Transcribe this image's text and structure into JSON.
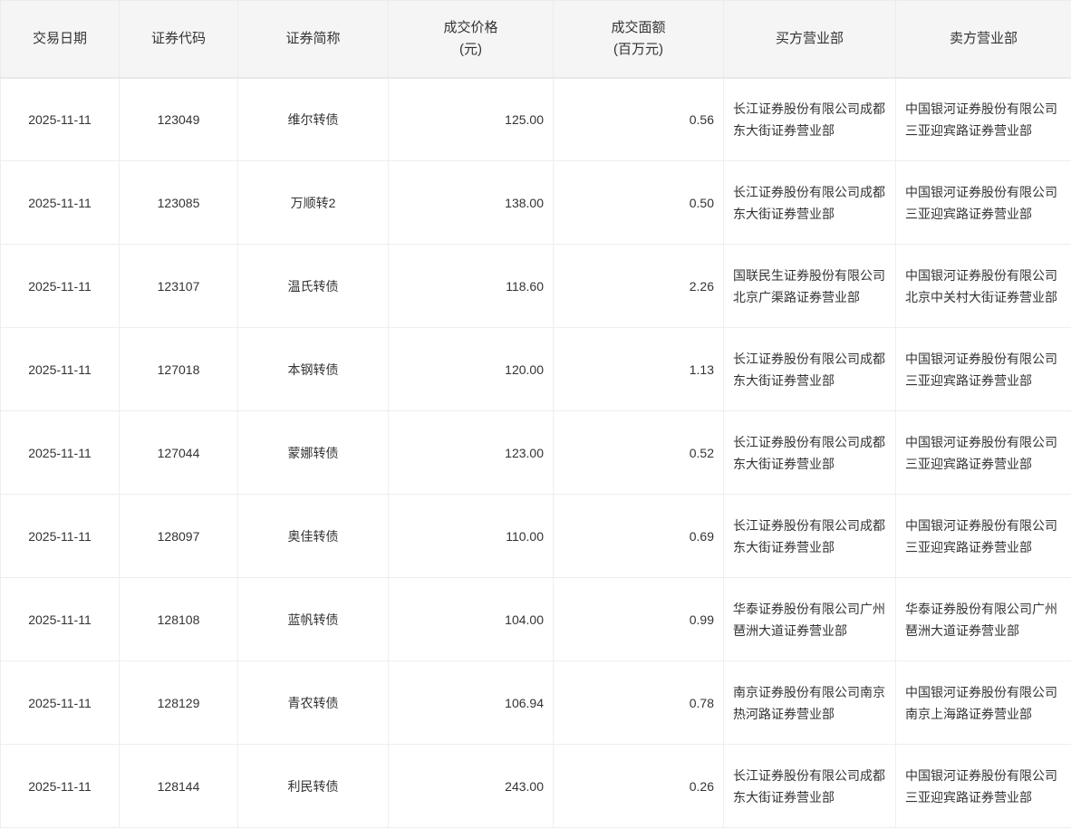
{
  "table": {
    "columns": [
      {
        "key": "date",
        "label": "交易日期",
        "align": "center"
      },
      {
        "key": "code",
        "label": "证券代码",
        "align": "center"
      },
      {
        "key": "name",
        "label": "证券简称",
        "align": "center"
      },
      {
        "key": "price",
        "label": "成交价格\n(元)",
        "align": "right"
      },
      {
        "key": "amount",
        "label": "成交面额\n(百万元)",
        "align": "right"
      },
      {
        "key": "buyer",
        "label": "买方营业部",
        "align": "left"
      },
      {
        "key": "seller",
        "label": "卖方营业部",
        "align": "left"
      }
    ],
    "rows": [
      {
        "date": "2025-11-11",
        "code": "123049",
        "name": "维尔转债",
        "price": "125.00",
        "amount": "0.56",
        "buyer": "长江证券股份有限公司成都东大街证券营业部",
        "seller": "中国银河证券股份有限公司三亚迎宾路证券营业部"
      },
      {
        "date": "2025-11-11",
        "code": "123085",
        "name": "万顺转2",
        "price": "138.00",
        "amount": "0.50",
        "buyer": "长江证券股份有限公司成都东大街证券营业部",
        "seller": "中国银河证券股份有限公司三亚迎宾路证券营业部"
      },
      {
        "date": "2025-11-11",
        "code": "123107",
        "name": "温氏转债",
        "price": "118.60",
        "amount": "2.26",
        "buyer": "国联民生证券股份有限公司北京广渠路证券营业部",
        "seller": "中国银河证券股份有限公司北京中关村大街证券营业部"
      },
      {
        "date": "2025-11-11",
        "code": "127018",
        "name": "本钢转债",
        "price": "120.00",
        "amount": "1.13",
        "buyer": "长江证券股份有限公司成都东大街证券营业部",
        "seller": "中国银河证券股份有限公司三亚迎宾路证券营业部"
      },
      {
        "date": "2025-11-11",
        "code": "127044",
        "name": "蒙娜转债",
        "price": "123.00",
        "amount": "0.52",
        "buyer": "长江证券股份有限公司成都东大街证券营业部",
        "seller": "中国银河证券股份有限公司三亚迎宾路证券营业部"
      },
      {
        "date": "2025-11-11",
        "code": "128097",
        "name": "奥佳转债",
        "price": "110.00",
        "amount": "0.69",
        "buyer": "长江证券股份有限公司成都东大街证券营业部",
        "seller": "中国银河证券股份有限公司三亚迎宾路证券营业部"
      },
      {
        "date": "2025-11-11",
        "code": "128108",
        "name": "蓝帆转债",
        "price": "104.00",
        "amount": "0.99",
        "buyer": "华泰证券股份有限公司广州琶洲大道证券营业部",
        "seller": "华泰证券股份有限公司广州琶洲大道证券营业部"
      },
      {
        "date": "2025-11-11",
        "code": "128129",
        "name": "青农转债",
        "price": "106.94",
        "amount": "0.78",
        "buyer": "南京证券股份有限公司南京热河路证券营业部",
        "seller": "中国银河证券股份有限公司南京上海路证券营业部"
      },
      {
        "date": "2025-11-11",
        "code": "128144",
        "name": "利民转债",
        "price": "243.00",
        "amount": "0.26",
        "buyer": "长江证券股份有限公司成都东大街证券营业部",
        "seller": "中国银河证券股份有限公司三亚迎宾路证券营业部"
      }
    ]
  }
}
